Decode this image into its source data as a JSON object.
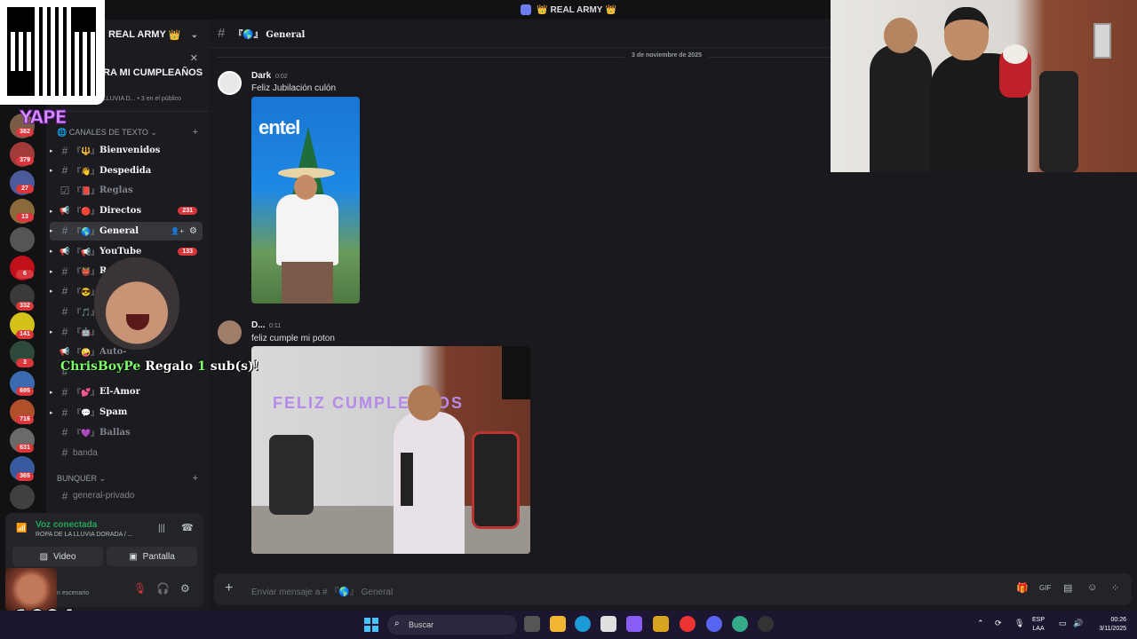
{
  "window": {
    "title": "REAL ARMY",
    "crown": "👑"
  },
  "server": {
    "name": "REAL ARMY",
    "crown": "👑",
    "event": {
      "title": "RA MI CUMPLEAÑOS",
      "subtitle": "LLUVIA D...  •  3 en el público"
    }
  },
  "rail": {
    "badges": [
      "382",
      "379",
      "27",
      "13",
      "",
      "6",
      "332",
      "141",
      "3",
      "695",
      "716",
      "631",
      "365"
    ]
  },
  "categories": [
    {
      "label": "CANALES DE TEXTO",
      "icon": "🌐"
    },
    {
      "label": "BUNQUER"
    }
  ],
  "channels": [
    {
      "emoji": "『🔱』",
      "name": "Bienvenidos",
      "unread": true,
      "type": "hash"
    },
    {
      "emoji": "『👋』",
      "name": "Despedida",
      "unread": true,
      "type": "hash"
    },
    {
      "emoji": "『📕』",
      "name": "Reglas",
      "unread": false,
      "type": "rules"
    },
    {
      "emoji": "『🔴』",
      "name": "Directos",
      "unread": true,
      "type": "announce",
      "count": "231"
    },
    {
      "emoji": "『🌎』",
      "name": "General",
      "unread": true,
      "active": true,
      "type": "hash"
    },
    {
      "emoji": "『📢』",
      "name": "YouTube",
      "unread": true,
      "type": "announce",
      "count": "133"
    },
    {
      "emoji": "『👹』",
      "name": "R",
      "unread": true,
      "type": "hash"
    },
    {
      "emoji": "『😎』",
      "name": "",
      "unread": true,
      "type": "hash"
    },
    {
      "emoji": "『🎵』",
      "name": "",
      "unread": false,
      "type": "hash"
    },
    {
      "emoji": "『🤖』",
      "name": "",
      "unread": true,
      "type": "hash"
    },
    {
      "emoji": "『🤪』",
      "name": "Auto-",
      "unread": false,
      "type": "announce"
    },
    {
      "emoji": "",
      "name": "",
      "unread": false,
      "type": "hash"
    },
    {
      "emoji": "『💕』",
      "name": "El-Amor",
      "unread": true,
      "type": "hash"
    },
    {
      "emoji": "『💬』",
      "name": "Spam",
      "unread": true,
      "type": "hash"
    },
    {
      "emoji": "『💜』",
      "name": "Ballas",
      "unread": false,
      "type": "hash"
    },
    {
      "emoji": "",
      "name": "banda",
      "unread": false,
      "type": "hash",
      "plain": true
    }
  ],
  "bunquer_channels": [
    {
      "name": "general-privado"
    }
  ],
  "voice": {
    "status": "Voz conectada",
    "channel": "ROPA DE LA LLUVIA DORADA / ...",
    "video_label": "Video",
    "screen_label": "Pantalla",
    "user_sub": "n escenario"
  },
  "chat": {
    "channel_title": "『🌎』 General",
    "date_divider": "3 de noviembre de 2025",
    "messages": [
      {
        "author": "Dark",
        "time": "0:02",
        "text": "Feliz Jubilación culón",
        "image_brand": "entel"
      },
      {
        "author": "D...",
        "time": "0:11",
        "text": "feliz cumple mi poton",
        "image_banner": "FELIZ CUMPLEAÑOS"
      }
    ],
    "input_placeholder": "Enviar mensaje a # 『🌎』 General"
  },
  "overlays": {
    "yape": "YAPE",
    "gift_name": "ChrisBoyPe",
    "gift_verb": "Regalo",
    "gift_count": "1",
    "gift_unit": "sub(s)!",
    "combo": "x1004"
  },
  "taskbar": {
    "search": "Buscar",
    "lang_top": "ESP",
    "lang_bottom": "LAA",
    "time": "00:26",
    "date": "3/11/2025"
  },
  "colors": {
    "accent_green": "#23a55a",
    "badge_red": "#da373c",
    "yape_purple": "#d493ff"
  }
}
